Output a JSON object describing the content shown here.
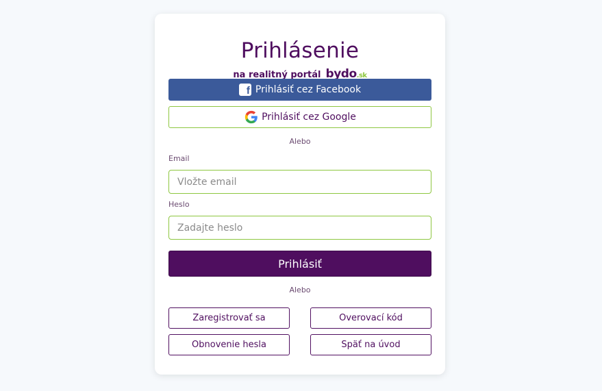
{
  "login": {
    "title": "Prihlásenie",
    "subtitle": "na realitný portál",
    "brand_name": "bydo",
    "brand_tld": ".sk",
    "facebook_button": "Prihlásiť cez Facebook",
    "google_button": "Prihlásiť cez Google",
    "divider_1": "Alebo",
    "email_label": "Email",
    "email_placeholder": "Vložte email",
    "email_value": "",
    "password_label": "Heslo",
    "password_placeholder": "Zadajte heslo",
    "password_value": "",
    "submit_button": "Prihlásiť",
    "divider_2": "Alebo",
    "links": {
      "register": "Zaregistrovať sa",
      "verification_code": "Overovací kód",
      "reset_password": "Obnovenie hesla",
      "back_home": "Späť na úvod"
    }
  },
  "colors": {
    "brand_purple": "#4f0e5f",
    "brand_green": "#8dc63f",
    "facebook_blue": "#3b5a9a",
    "background": "#f6f9fc"
  },
  "icons": {
    "facebook": "facebook-icon",
    "google": "google-icon"
  }
}
